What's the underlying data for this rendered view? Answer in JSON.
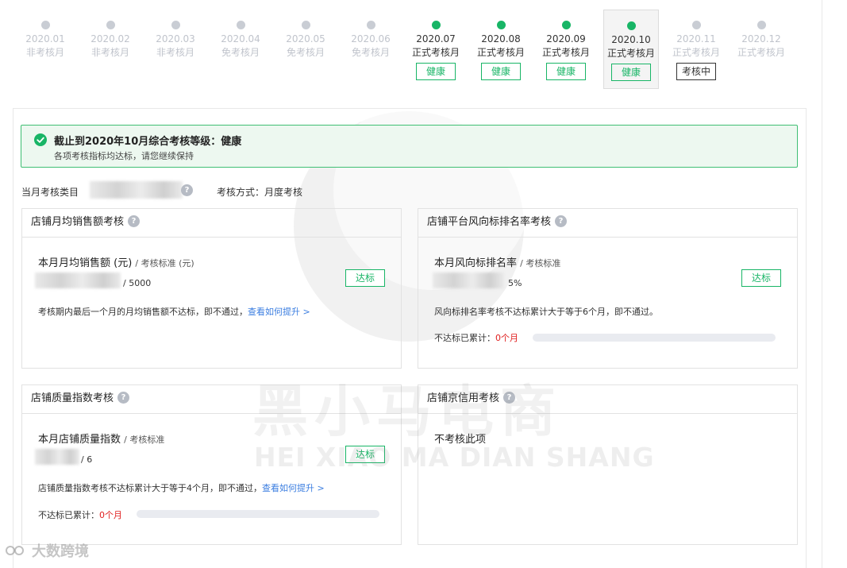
{
  "timeline": [
    {
      "date": "2020.01",
      "kind": "非考核月",
      "status": "",
      "state": "inactive"
    },
    {
      "date": "2020.02",
      "kind": "非考核月",
      "status": "",
      "state": "inactive"
    },
    {
      "date": "2020.03",
      "kind": "非考核月",
      "status": "",
      "state": "inactive"
    },
    {
      "date": "2020.04",
      "kind": "免考核月",
      "status": "",
      "state": "inactive"
    },
    {
      "date": "2020.05",
      "kind": "免考核月",
      "status": "",
      "state": "inactive"
    },
    {
      "date": "2020.06",
      "kind": "免考核月",
      "status": "",
      "state": "inactive"
    },
    {
      "date": "2020.07",
      "kind": "正式考核月",
      "status": "健康",
      "state": "active"
    },
    {
      "date": "2020.08",
      "kind": "正式考核月",
      "status": "健康",
      "state": "active"
    },
    {
      "date": "2020.09",
      "kind": "正式考核月",
      "status": "健康",
      "state": "active"
    },
    {
      "date": "2020.10",
      "kind": "正式考核月",
      "status": "健康",
      "state": "selected"
    },
    {
      "date": "2020.11",
      "kind": "正式考核月",
      "status": "考核中",
      "state": "pending"
    },
    {
      "date": "2020.12",
      "kind": "正式考核月",
      "status": "",
      "state": "inactive"
    }
  ],
  "alert": {
    "title": "截止到2020年10月综合考核等级：健康",
    "subtitle": "各项考核指标均达标，请您继续保持"
  },
  "meta": {
    "category_label": "当月考核类目",
    "method_label": "考核方式：",
    "method_value": "月度考核"
  },
  "cards": {
    "sales": {
      "title": "店铺月均销售额考核",
      "metric": "本月月均销售额 (元)",
      "standard_label": "/ 考核标准 (元)",
      "standard_value": "/ 5000",
      "badge": "达标",
      "rule": "考核期内最后一个月的月均销售额不达标，即不通过，",
      "link": "查看如何提升 >"
    },
    "ranking": {
      "title": "店铺平台风向标排名率考核",
      "metric": "本月风向标排名率",
      "standard_label": "/ 考核标准",
      "standard_value": "5%",
      "badge": "达标",
      "rule": "风向标排名率考核不达标累计大于等于6个月，即不通过。",
      "accumulated_label": "不达标已累计：",
      "accumulated_value": "0个月",
      "accumulated_months": 0
    },
    "quality": {
      "title": "店铺质量指数考核",
      "metric": "本月店铺质量指数",
      "standard_label": "/ 考核标准",
      "standard_value": "/ 6",
      "badge": "达标",
      "rule": "店铺质量指数考核不达标累计大于等于4个月，即不通过，",
      "link": "查看如何提升 >",
      "accumulated_label": "不达标已累计：",
      "accumulated_value": "0个月",
      "accumulated_months": 0
    },
    "credit": {
      "title": "店铺京信用考核",
      "note": "不考核此项"
    }
  },
  "help_glyph": "?",
  "watermark": {
    "big": "黑小马电商",
    "small": "HEI XIAO MA DIAN SHANG",
    "corner": "大数跨境"
  },
  "colors": {
    "green": "#18b566",
    "alert_bg": "#edf8f0",
    "link": "#3a7de0",
    "red": "#e02020",
    "inactive": "#c0c4cc"
  }
}
